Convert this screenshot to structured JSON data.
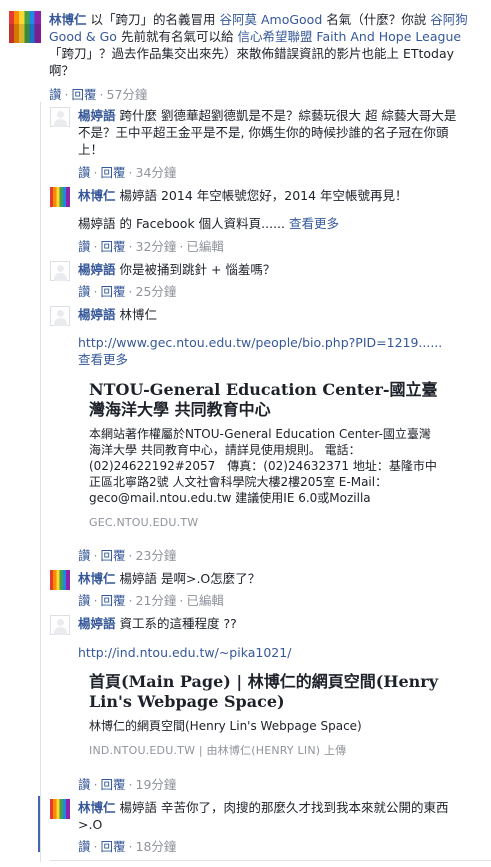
{
  "top": {
    "name": "林博仁",
    "text_prefix": "以「跨刀」的名義冒用",
    "tag1": "谷阿莫 AmoGood",
    "mid1": "名氣（什麼？你說",
    "tag2": "谷阿狗 Good & Go",
    "mid2": "先前就有名氣可以給",
    "tag3": "信心希望聯盟 Faith And Hope League",
    "rest": "「跨刀」？過去作品集交出來先）來散佈錯誤資訊的影片也能上 ETtoday 啊？",
    "like": "讚",
    "reply": "回覆",
    "time": "57分鐘"
  },
  "replies": [
    {
      "name": "楊婷語",
      "text": "跨什麼 劉德華超劉德凱是不是？綜藝玩很大 超 綜藝大哥大是不是？王中平超王金平是不是, 你媽生你的時候抄誰的名子冠在你頭上！",
      "like": "讚",
      "reply": "回覆",
      "time": "34分鐘"
    },
    {
      "name": "林博仁",
      "text": "楊婷語 2014 年空帳號您好，2014 年空帳號再見！",
      "text2": "楊婷語 的 Facebook 個人資料頁......",
      "more": "查看更多",
      "like": "讚",
      "reply": "回覆",
      "time": "32分鐘",
      "edited": "已編輯"
    },
    {
      "name": "楊婷語",
      "text": "你是被捅到跳針 + 惱羞嗎？",
      "like": "讚",
      "reply": "回覆",
      "time": "25分鐘"
    },
    {
      "name": "楊婷語",
      "text": "林博仁",
      "url": "http://www.gec.ntou.edu.tw/people/bio.php?PID=1219......",
      "more": "查看更多",
      "preview_title": "NTOU-General Education Center-國立臺灣海洋大學 共同教育中心",
      "preview_desc": "本網站著作權屬於NTOU-General Education Center-國立臺灣海洋大學 共同教育中心，請詳見使用規則。 電話：(02)24622192#2057　傳真：(02)24632371 地址：基隆市中正區北寧路2號 人文社會科學院大樓2樓205室 E-Mail：geco@mail.ntou.edu.tw 建議使用IE 6.0或Mozilla",
      "preview_domain": "GEC.NTOU.EDU.TW",
      "like": "讚",
      "reply": "回覆",
      "time": "23分鐘"
    },
    {
      "name": "林博仁",
      "text": "楊婷語 是啊>.O怎麼了？",
      "like": "讚",
      "reply": "回覆",
      "time": "21分鐘",
      "edited": "已編輯"
    },
    {
      "name": "楊婷語",
      "text": "資工系的這種程度 ??",
      "url": "http://ind.ntou.edu.tw/~pika1021/",
      "preview_title": "首頁(Main Page) | 林博仁的網頁空間(Henry Lin's Webpage Space)",
      "preview_desc": "林博仁的網頁空間(Henry Lin's Webpage Space)",
      "preview_domain": "IND.NTOU.EDU.TW | 由林博仁(HENRY LIN) 上傳",
      "like": "讚",
      "reply": "回覆",
      "time": "19分鐘"
    },
    {
      "name": "林博仁",
      "text": "楊婷語 辛苦你了，肉搜的那麼久才找到我本來就公開的東西 >.O",
      "like": "讚",
      "reply": "回覆",
      "time": "18分鐘"
    }
  ]
}
